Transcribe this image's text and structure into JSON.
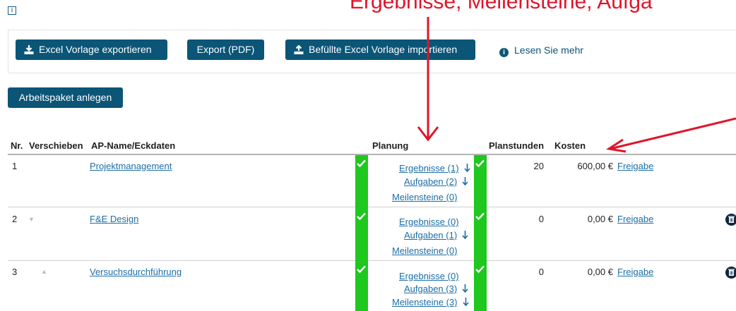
{
  "overlay": {
    "text": "Ergebnisse, Meilensteine, Aufga"
  },
  "toolbar": {
    "export_excel": "Excel Vorlage exportieren",
    "export_pdf": "Export (PDF)",
    "import_excel": "Befüllte Excel Vorlage importieren",
    "read_more": "Lesen Sie mehr"
  },
  "create_button": "Arbeitspaket anlegen",
  "table": {
    "headers": {
      "nr": "Nr.",
      "move": "Verschieben",
      "name": "AP-Name/Eckdaten",
      "planning": "Planung",
      "hours": "Planstunden",
      "cost": "Kosten"
    },
    "rows": [
      {
        "nr": "1",
        "name": "Projektmanagement",
        "results": "Ergebnisse (1)",
        "tasks": "Aufgaben (2)",
        "milestones": "Meilensteine (0)",
        "hours": "20",
        "cost": "600,00 €",
        "release": "Freigabe"
      },
      {
        "nr": "2",
        "name": "F&E Design",
        "results": "Ergebnisse (0)",
        "tasks": "Aufgaben (1)",
        "milestones": "Meilensteine (0)",
        "hours": "0",
        "cost": "0,00 €",
        "release": "Freigabe"
      },
      {
        "nr": "3",
        "name": "Versuchsdurchführung",
        "results": "Ergebnisse (0)",
        "tasks": "Aufgaben (3)",
        "milestones": "Meilensteine (3)",
        "hours": "0",
        "cost": "0,00 €",
        "release": "Freigabe"
      }
    ]
  },
  "colors": {
    "primary": "#0b5577",
    "link": "#1c6ea4",
    "status_green": "#1ec81e",
    "annotation_red": "#e0152a"
  }
}
